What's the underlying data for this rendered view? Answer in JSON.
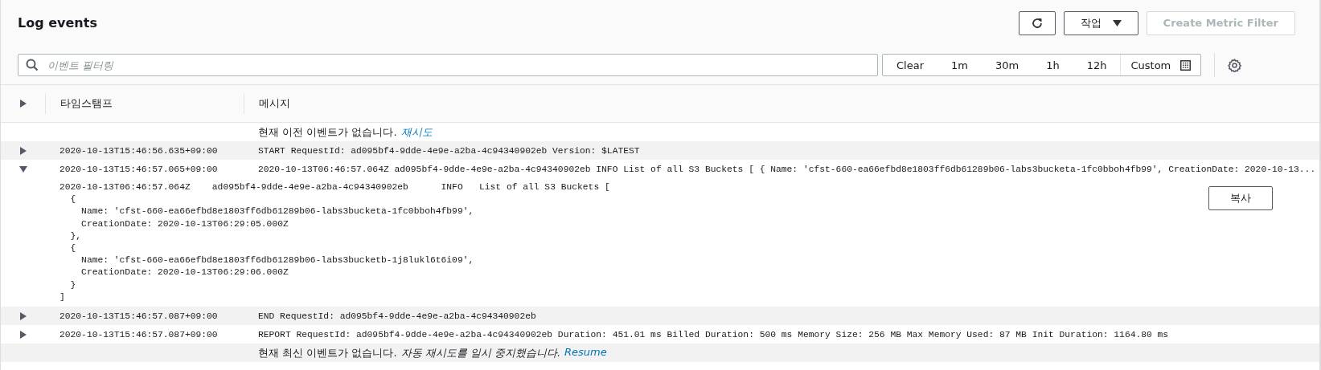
{
  "header": {
    "title": "Log events",
    "actions_label": "작업",
    "create_filter_label": "Create Metric Filter",
    "create_filter_disabled": true
  },
  "filter": {
    "placeholder": "이벤트 필터링"
  },
  "time_ranges": [
    {
      "label": "Clear",
      "kind": "plain"
    },
    {
      "label": "1m",
      "kind": "plain"
    },
    {
      "label": "30m",
      "kind": "plain"
    },
    {
      "label": "1h",
      "kind": "plain"
    },
    {
      "label": "12h",
      "kind": "plain"
    },
    {
      "label": "Custom",
      "kind": "custom"
    }
  ],
  "table": {
    "columns": [
      "타임스탬프",
      "메시지"
    ],
    "rows": [
      {
        "kind": "note",
        "text": "현재 이전 이벤트가 없습니다.",
        "link": "재시도"
      },
      {
        "kind": "event",
        "expanded": false,
        "timestamp": "2020-10-13T15:46:56.635+09:00",
        "message": "START RequestId: ad095bf4-9dde-4e9e-a2ba-4c94340902eb Version: $LATEST"
      },
      {
        "kind": "event",
        "expanded": true,
        "timestamp": "2020-10-13T15:46:57.065+09:00",
        "message": "2020-10-13T06:46:57.064Z ad095bf4-9dde-4e9e-a2ba-4c94340902eb INFO List of all S3 Buckets [ { Name: 'cfst-660-ea66efbd8e1803ff6db61289b06-labs3bucketa-1fc0bboh4fb99', CreationDate: 2020-10-13...",
        "detail": [
          "2020-10-13T06:46:57.064Z\tad095bf4-9dde-4e9e-a2ba-4c94340902eb\tINFO\tList of all S3 Buckets [",
          "  {",
          "    Name: 'cfst-660-ea66efbd8e1803ff6db61289b06-labs3bucketa-1fc0bboh4fb99',",
          "    CreationDate: 2020-10-13T06:29:05.000Z",
          "  },",
          "  {",
          "    Name: 'cfst-660-ea66efbd8e1803ff6db61289b06-labs3bucketb-1j8lukl6t6i09',",
          "    CreationDate: 2020-10-13T06:29:06.000Z",
          "  }",
          "]"
        ],
        "copy_label": "복사"
      },
      {
        "kind": "event",
        "expanded": false,
        "timestamp": "2020-10-13T15:46:57.087+09:00",
        "message": "END RequestId: ad095bf4-9dde-4e9e-a2ba-4c94340902eb"
      },
      {
        "kind": "event",
        "expanded": false,
        "timestamp": "2020-10-13T15:46:57.087+09:00",
        "message": "REPORT RequestId: ad095bf4-9dde-4e9e-a2ba-4c94340902eb Duration: 451.01 ms Billed Duration: 500 ms Memory Size: 256 MB Max Memory Used: 87 MB Init Duration: 1164.80 ms"
      },
      {
        "kind": "note",
        "text": "현재 최신 이벤트가 없습니다.",
        "status": "자동 재시도를 일시 중지했습니다.",
        "link": "Resume"
      }
    ]
  }
}
